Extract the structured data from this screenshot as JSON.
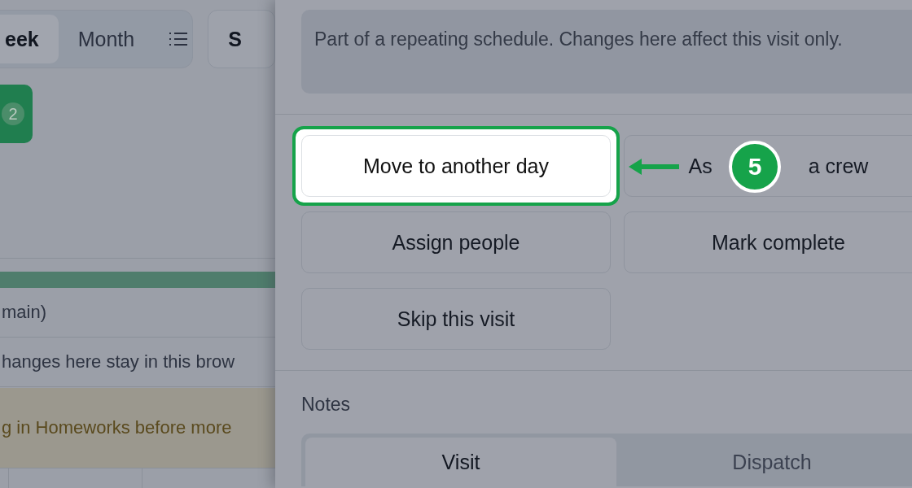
{
  "calendar": {
    "view_tabs": [
      {
        "label": "eek",
        "selected": true
      },
      {
        "label": "Month",
        "selected": false
      }
    ],
    "side_button": "S",
    "event_badge": "2",
    "row_label": "main)",
    "notice": "hanges here stay in this brow",
    "warning": "g in Homeworks before more"
  },
  "drawer": {
    "info": "Part of a repeating schedule. Changes here affect this visit only.",
    "actions": [
      {
        "label": "Move to another day",
        "highlighted": true
      },
      {
        "label": "As",
        "label_after_marker": "a crew",
        "highlighted": false
      },
      {
        "label": "Assign people",
        "highlighted": false
      },
      {
        "label": "Mark complete",
        "highlighted": false
      },
      {
        "label": "Skip this visit",
        "highlighted": false
      }
    ],
    "notes": {
      "title": "Notes",
      "tabs": [
        {
          "label": "Visit",
          "selected": true
        },
        {
          "label": "Dispatch",
          "selected": false
        }
      ]
    }
  },
  "tutorial": {
    "step": "5"
  }
}
